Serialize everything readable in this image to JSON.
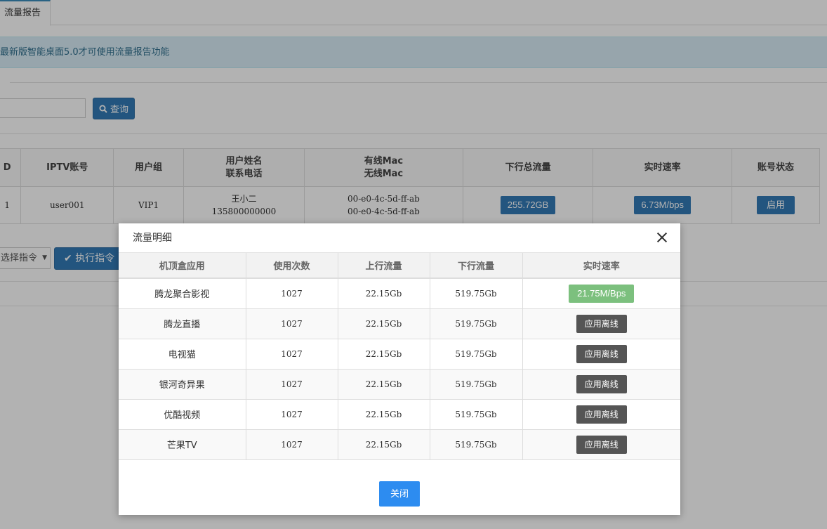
{
  "tabs": [
    {
      "label": "流量报告"
    }
  ],
  "notice": {
    "text": "最新版智能桌面5.0才可使用流量报告功能"
  },
  "search": {
    "button_label": "查询"
  },
  "main_table": {
    "headers": [
      "D",
      "IPTV账号",
      "用户组",
      "用户姓名",
      "联系电话",
      "有线Mac",
      "无线Mac",
      "下行总流量",
      "实时速率",
      "账号状态"
    ],
    "row": {
      "id": "1",
      "account": "user001",
      "group": "VIP1",
      "name": "王小二",
      "phone": "135800000000",
      "wired_mac": "00-e0-4c-5d-ff-ab",
      "wireless_mac": "00-e0-4c-5d-ff-ab",
      "total_downstream": "255.72GB",
      "realtime_rate": "6.73M/bps",
      "status": "启用"
    }
  },
  "command": {
    "select_placeholder": "选择指令",
    "execute_label": "执行指令"
  },
  "modal": {
    "title": "流量明细",
    "headers": [
      "机顶盒应用",
      "使用次数",
      "上行流量",
      "下行流量",
      "实时速率"
    ],
    "rows": [
      {
        "app": "腾龙聚合影视",
        "count": "1027",
        "up": "22.15Gb",
        "down": "519.75Gb",
        "rate": "21.75M/Bps",
        "online": true
      },
      {
        "app": "腾龙直播",
        "count": "1027",
        "up": "22.15Gb",
        "down": "519.75Gb",
        "rate": "应用离线",
        "online": false
      },
      {
        "app": "电视猫",
        "count": "1027",
        "up": "22.15Gb",
        "down": "519.75Gb",
        "rate": "应用离线",
        "online": false
      },
      {
        "app": "银河奇异果",
        "count": "1027",
        "up": "22.15Gb",
        "down": "519.75Gb",
        "rate": "应用离线",
        "online": false
      },
      {
        "app": "优酷视频",
        "count": "1027",
        "up": "22.15Gb",
        "down": "519.75Gb",
        "rate": "应用离线",
        "online": false
      },
      {
        "app": "芒果TV",
        "count": "1027",
        "up": "22.15Gb",
        "down": "519.75Gb",
        "rate": "应用离线",
        "online": false
      }
    ],
    "close_label": "关闭"
  },
  "colors": {
    "primary": "#337ab7",
    "online": "#7cc07e",
    "offline": "#555555",
    "close_button": "#2d8cf0"
  }
}
